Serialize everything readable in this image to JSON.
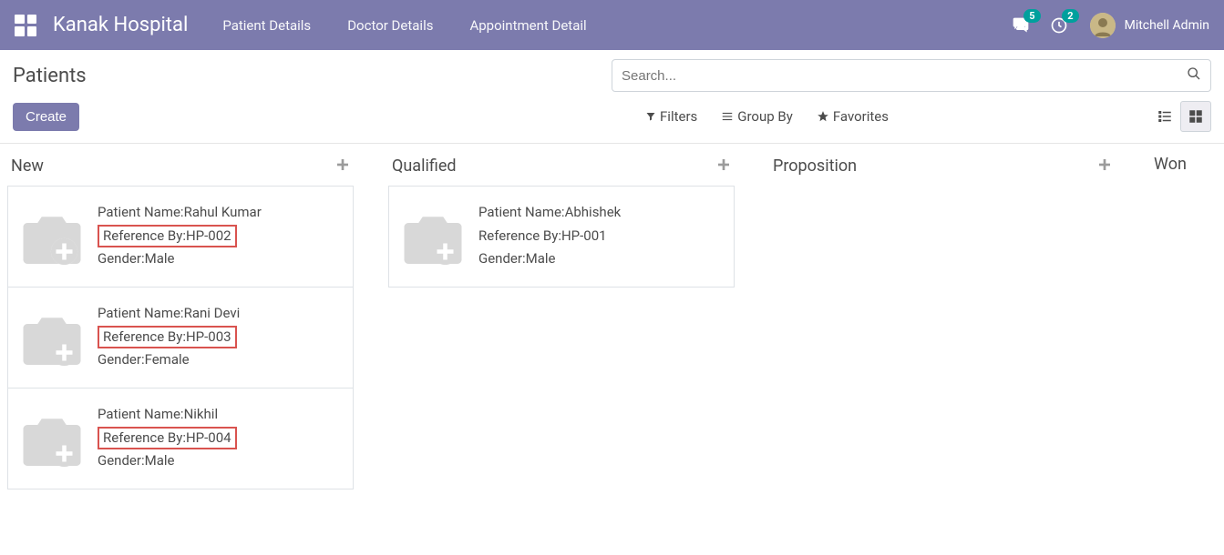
{
  "navbar": {
    "brand": "Kanak Hospital",
    "links": [
      "Patient Details",
      "Doctor Details",
      "Appointment Detail"
    ],
    "messages_badge": "5",
    "activities_badge": "2",
    "user_name": "Mitchell Admin"
  },
  "control_panel": {
    "title": "Patients",
    "create_label": "Create",
    "search_placeholder": "Search...",
    "filters_label": "Filters",
    "groupby_label": "Group By",
    "favorites_label": "Favorites"
  },
  "labels": {
    "patient_name": "Patient Name:",
    "reference_by": "Reference By:",
    "gender": "Gender:"
  },
  "columns": [
    {
      "title": "New",
      "show_add": true,
      "cards": [
        {
          "name": "Rahul Kumar",
          "ref": "HP-002",
          "gender": "Male",
          "highlight_ref": true
        },
        {
          "name": "Rani Devi",
          "ref": "HP-003",
          "gender": "Female",
          "highlight_ref": true
        },
        {
          "name": "Nikhil",
          "ref": "HP-004",
          "gender": "Male",
          "highlight_ref": true
        }
      ]
    },
    {
      "title": "Qualified",
      "show_add": true,
      "cards": [
        {
          "name": "Abhishek",
          "ref": "HP-001",
          "gender": "Male",
          "highlight_ref": false
        }
      ]
    },
    {
      "title": "Proposition",
      "show_add": true,
      "cards": []
    },
    {
      "title": "Won",
      "show_add": false,
      "cards": []
    }
  ]
}
